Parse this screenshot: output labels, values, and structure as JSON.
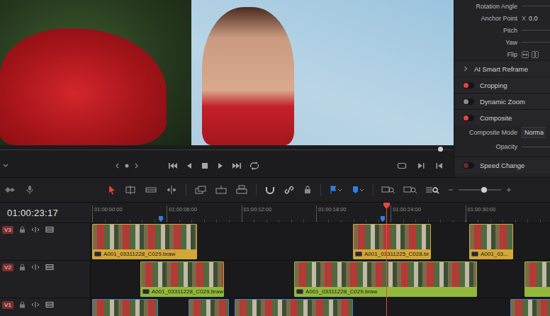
{
  "viewer": {
    "scrubber": {
      "level": 0.97
    }
  },
  "inspector": {
    "transform_rows": [
      {
        "label": "Rotation Angle",
        "kind": "slider"
      },
      {
        "label": "Anchor Point",
        "kind": "xy",
        "axis": "X",
        "value": "0.0"
      },
      {
        "label": "Pitch",
        "kind": "slider"
      },
      {
        "label": "Yaw",
        "kind": "slider"
      },
      {
        "label": "Flip",
        "kind": "flip"
      }
    ],
    "sections": [
      {
        "label": "AI Smart Reframe",
        "kind": "collapsed",
        "expanded": false
      },
      {
        "label": "Cropping",
        "kind": "toggle",
        "on": true,
        "disabled": false
      },
      {
        "label": "Dynamic Zoom",
        "kind": "toggle",
        "on": false,
        "disabled": false
      },
      {
        "label": "Composite",
        "kind": "toggle",
        "on": true,
        "disabled": false
      }
    ],
    "composite_fields": [
      {
        "label": "Composite Mode",
        "kind": "dropdown",
        "value": "Norma"
      },
      {
        "label": "Opacity",
        "kind": "slider"
      }
    ],
    "speed": {
      "label": "Speed Change",
      "on": true,
      "disabled": true
    }
  },
  "toolbar": {
    "zoom": {
      "level": 0.6
    }
  },
  "timeline": {
    "timecode": "01:00:23:17",
    "ruler": [
      "01:00:00:00",
      "01:00:06:00",
      "01:00:12:00",
      "01:00:18:00",
      "01:00:24:00",
      "01:00:30:00"
    ],
    "tracks": [
      {
        "name": "V3",
        "clips": [
          {
            "label": "A001_03311228_C029.braw",
            "color": "#d3a736"
          },
          {
            "label": "A001_03311225_C028.br",
            "color": "#d3a736"
          },
          {
            "label": "A001_03...",
            "color": "#d3a736"
          }
        ]
      },
      {
        "name": "V2",
        "clips": [
          {
            "label": "A001_03311228_C029.braw",
            "color": "#92b83c"
          },
          {
            "label": "A001_03311228_C029.braw",
            "color": "#92b83c"
          },
          {
            "color": "#92b83c"
          }
        ]
      },
      {
        "name": "V1",
        "clips": [
          {
            "color": "#3f7fc7"
          },
          {
            "color": "#3f7fc7"
          },
          {
            "color": "#3f7fc7"
          },
          {
            "color": "#3f7fc7"
          }
        ]
      }
    ]
  }
}
